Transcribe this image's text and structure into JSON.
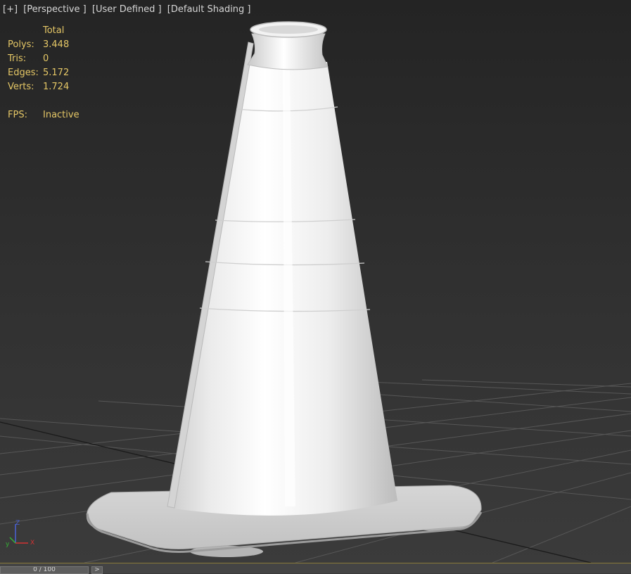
{
  "viewport": {
    "menu": {
      "plus": "[+]",
      "view": "[Perspective ]",
      "mode": "[User Defined ]",
      "shading": "[Default Shading ]"
    },
    "stats": {
      "header": "Total",
      "rows": [
        {
          "label": "Polys:",
          "value": "3.448"
        },
        {
          "label": "Tris:",
          "value": "0"
        },
        {
          "label": "Edges:",
          "value": "5.172"
        },
        {
          "label": "Verts:",
          "value": "1.724"
        }
      ],
      "fps_label": "FPS:",
      "fps_value": "Inactive"
    },
    "axis": {
      "z": "Z",
      "y": "y",
      "x": "X"
    },
    "object": "traffic-cone"
  },
  "timeline": {
    "slider": "0 / 100",
    "next_button": ">"
  },
  "colors": {
    "stats_text": "#e5c766",
    "menu_text": "#d6d6d6",
    "background": "#2f2f2f",
    "grid": "#5a5a5a",
    "axis_x": "#d23232",
    "axis_y": "#35b235",
    "axis_z": "#4a62d8"
  }
}
